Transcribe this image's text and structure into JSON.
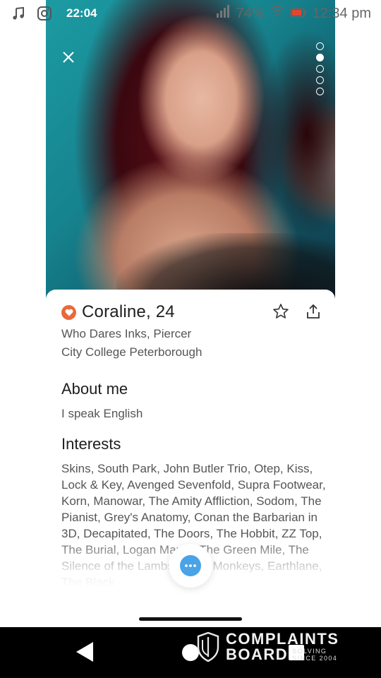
{
  "status_bar": {
    "time": "22:04",
    "battery": "74%",
    "clock_right": "12:34 pm"
  },
  "photo": {
    "image_count": 5,
    "active_index": 1,
    "close_icon": "close-icon"
  },
  "profile": {
    "name_age": "Coraline, 24",
    "occupation": "Who Dares Inks, Piercer",
    "education": "City College Peterborough",
    "badge_color": "#e9693a"
  },
  "about": {
    "title": "About me",
    "text": "I speak English"
  },
  "interests": {
    "title": "Interests",
    "text": "Skins, South Park, John Butler Trio, Otep, Kiss, Lock & Key, Avenged Sevenfold, Supra Footwear, Korn, Manowar, The Amity Affliction, Sodom, The Pianist, Grey's Anatomy, Conan the Barbarian in 3D, Decapitated, The Doors, The Hobbit, ZZ Top, The Burial, Logan Martin, The Green Mile, The Silence of the Lambs, Arctic Monkeys, Earthlane, The Black"
  },
  "chat": {
    "icon": "chat-bubble-icon",
    "color": "#4aa3e6"
  },
  "watermark": {
    "line1": "COMPLAINTS",
    "line2": "BOARD",
    "tag1": "SOLVING",
    "tag2": "SINCE 2004"
  }
}
